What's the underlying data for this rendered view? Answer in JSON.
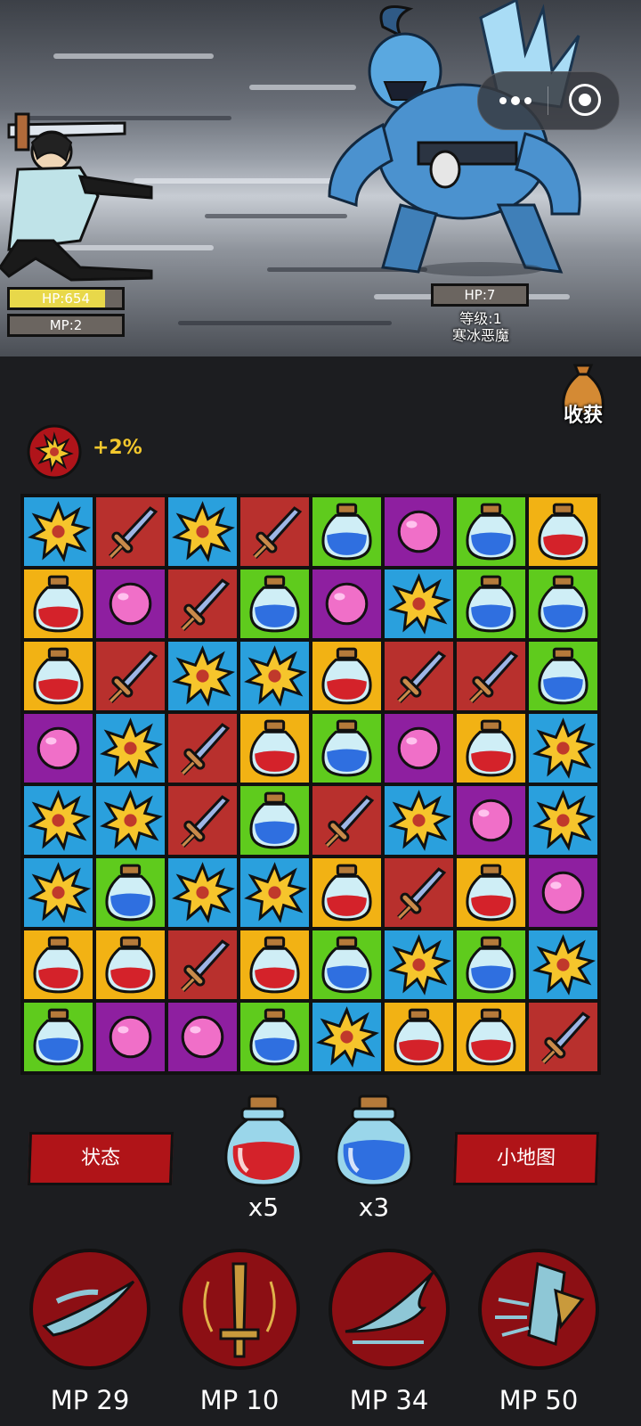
{
  "player": {
    "hp_label": "HP:654",
    "hp_fraction": 0.85,
    "mp_label": "MP:2"
  },
  "enemy": {
    "hp_label": "HP:7",
    "level_label": "等级:1",
    "name": "寒冰恶魔"
  },
  "harvest": {
    "label": "收获",
    "icon": "loot-bag-icon"
  },
  "buff": {
    "icon": "explosion-icon",
    "text": "+2%"
  },
  "board": {
    "rows": [
      [
        "star",
        "sword",
        "star",
        "sword",
        "blue",
        "orb",
        "blue",
        "red"
      ],
      [
        "red",
        "orb",
        "sword",
        "blue",
        "orb",
        "star",
        "blue",
        "blue"
      ],
      [
        "red",
        "sword",
        "star",
        "star",
        "red",
        "sword",
        "sword",
        "blue"
      ],
      [
        "orb",
        "star",
        "sword",
        "red",
        "blue",
        "orb",
        "red",
        "star"
      ],
      [
        "star",
        "star",
        "sword",
        "blue",
        "sword",
        "star",
        "orb",
        "star"
      ],
      [
        "star",
        "blue",
        "star",
        "star",
        "red",
        "sword",
        "red",
        "orb"
      ],
      [
        "red",
        "red",
        "sword",
        "red",
        "blue",
        "star",
        "blue",
        "star"
      ],
      [
        "blue",
        "orb",
        "orb",
        "blue",
        "star",
        "red",
        "red",
        "sword"
      ]
    ]
  },
  "buttons": {
    "status": "状态",
    "minimap": "小地图"
  },
  "potions": {
    "red_count": "x5",
    "blue_count": "x3"
  },
  "skills": [
    {
      "icon": "wind-slash-icon",
      "cost": "MP 29"
    },
    {
      "icon": "sword-aura-icon",
      "cost": "MP 10"
    },
    {
      "icon": "wave-slash-icon",
      "cost": "MP 34"
    },
    {
      "icon": "blade-burst-icon",
      "cost": "MP 50"
    }
  ],
  "colors": {
    "red_button": "#b01418",
    "buff_text": "#f2c72d",
    "hp_fill": "#e8d84a"
  }
}
